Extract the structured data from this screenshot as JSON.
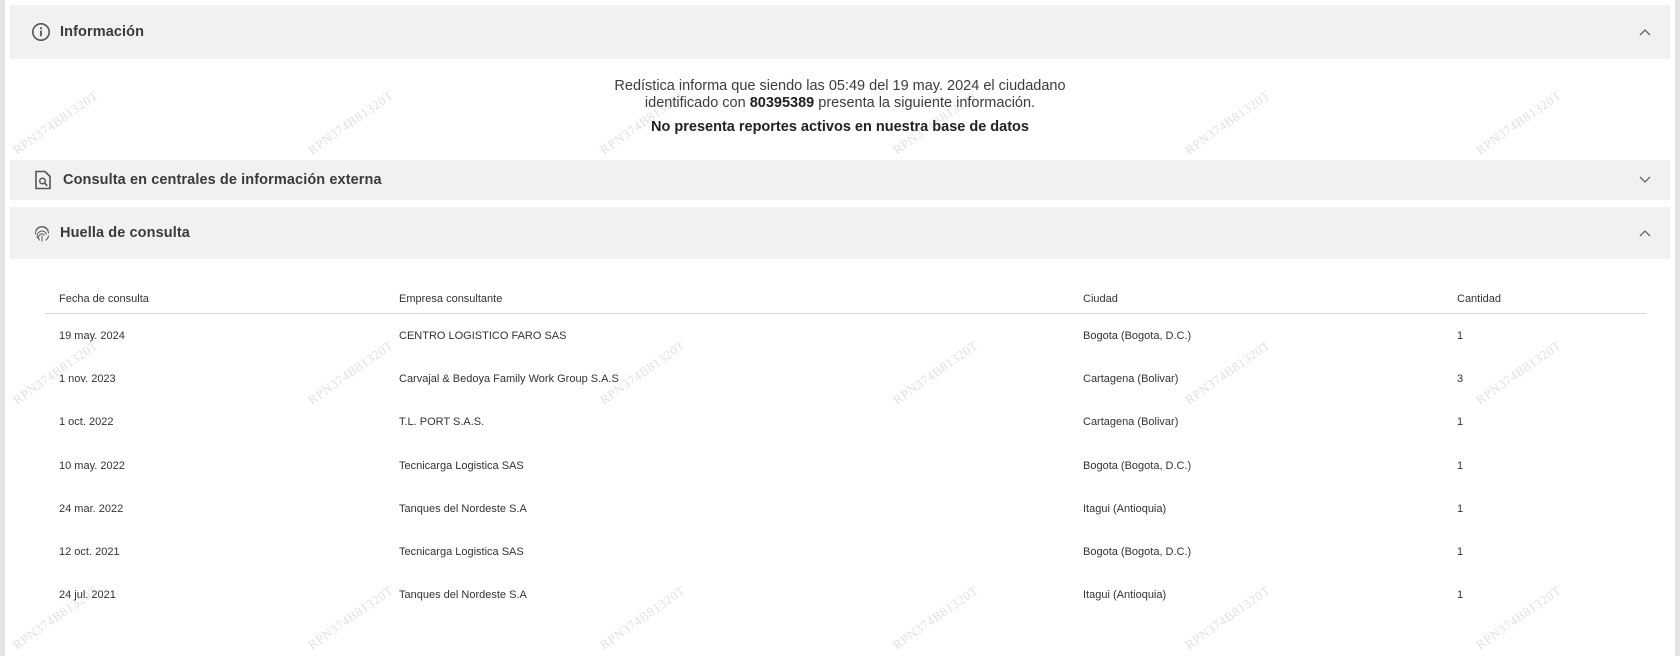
{
  "sections": {
    "info": {
      "title": "Información",
      "icon": "info-circle-icon",
      "expanded": true
    },
    "external": {
      "title": "Consulta en centrales de información externa",
      "icon": "document-search-icon",
      "expanded": false
    },
    "huella": {
      "title": "Huella de consulta",
      "icon": "fingerprint-icon",
      "expanded": true
    }
  },
  "info_body": {
    "line1": "Redística informa que siendo las 05:49 del 19 may. 2024 el ciudadano",
    "line2_prefix": "identificado con",
    "id_number": "80395389",
    "line2_suffix": "presenta la siguiente información.",
    "line3": "No presenta reportes activos en nuestra base de datos"
  },
  "table": {
    "headers": [
      "Fecha de consulta",
      "Empresa consultante",
      "Ciudad",
      "Cantidad"
    ],
    "rows": [
      [
        "19 may. 2024",
        "CENTRO LOGISTICO FARO SAS",
        "Bogota (Bogota, D.C.)",
        "1"
      ],
      [
        "1 nov. 2023",
        "Carvajal & Bedoya Family Work Group S.A.S",
        "Cartagena (Bolivar)",
        "3"
      ],
      [
        "1 oct. 2022",
        "T.L. PORT S.A.S.",
        "Cartagena (Bolivar)",
        "1"
      ],
      [
        "10 may. 2022",
        "Tecnicarga Logistica SAS",
        "Bogota (Bogota, D.C.)",
        "1"
      ],
      [
        "24 mar. 2022",
        "Tanques del Nordeste S.A",
        "Itagui (Antioquia)",
        "1"
      ],
      [
        "12 oct. 2021",
        "Tecnicarga Logistica SAS",
        "Bogota (Bogota, D.C.)",
        "1"
      ],
      [
        "24 jul. 2021",
        "Tanques del Nordeste S.A",
        "Itagui (Antioquia)",
        "1"
      ]
    ]
  },
  "watermark": "RPN374B81320T",
  "colors": {
    "header_bg": "#f1f1f1",
    "page_bg": "#ffffff",
    "text": "#333333"
  }
}
